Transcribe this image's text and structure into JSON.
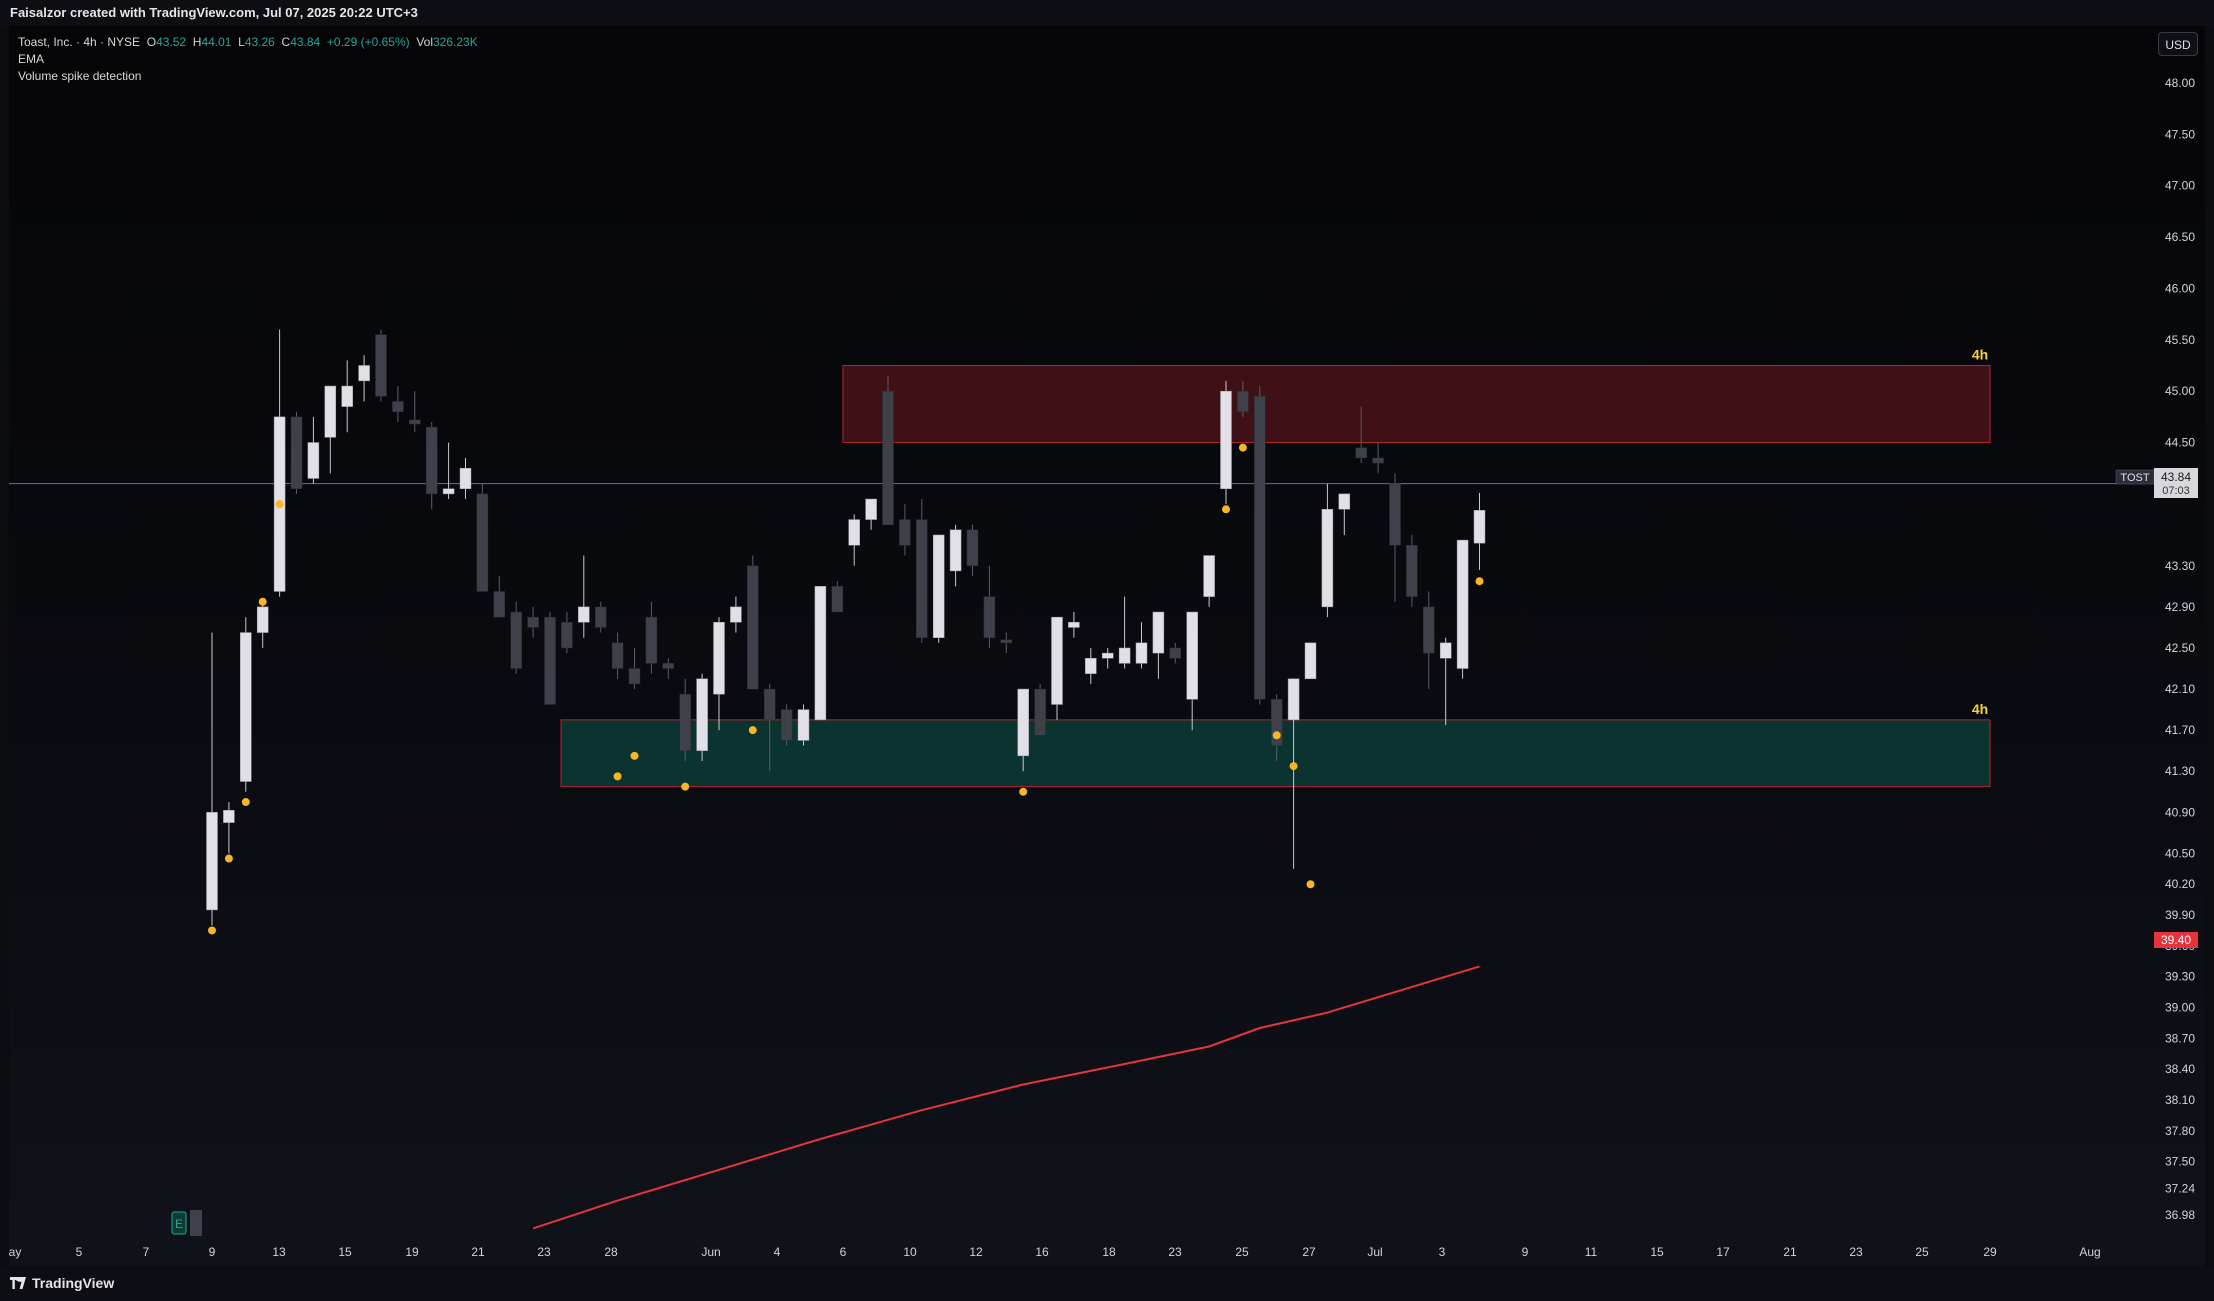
{
  "header": {
    "attribution": "Faisalzor created with TradingView.com, Jul 07, 2025 20:22 UTC+3"
  },
  "legend": {
    "symbol_line": "Toast, Inc. · 4h · NYSE",
    "o_label": "O",
    "o_value": "43.52",
    "h_label": "H",
    "h_value": "44.01",
    "l_label": "L",
    "l_value": "43.26",
    "c_label": "C",
    "c_value": "43.84",
    "change": "+0.29 (+0.65%)",
    "vol_label": "Vol",
    "vol_value": "326.23K",
    "indicator_1": "EMA",
    "indicator_2": "Volume spike detection"
  },
  "currency_button": "USD",
  "footer": {
    "brand": "TradingView"
  },
  "colors": {
    "bull": "#e0e0e6",
    "bear": "#3f414a",
    "dot": "#f7b623",
    "ema": "#e5343e",
    "hline": "#4a78c2",
    "resistance_fill": "#3f1016",
    "resistance_border": "#b2272e",
    "support_fill": "#0b3330",
    "support_border": "#b2272e",
    "zone_label": "#f5d238"
  },
  "chart_data": {
    "type": "candlestick",
    "symbol": "TOST",
    "timeframe": "4h",
    "y_axis": {
      "range": [
        36.84,
        48.35
      ],
      "ticks": [
        "48.00",
        "47.50",
        "47.00",
        "46.50",
        "46.00",
        "45.50",
        "45.00",
        "44.50",
        "44.10",
        "43.30",
        "42.90",
        "42.50",
        "42.10",
        "41.70",
        "41.30",
        "40.90",
        "40.50",
        "40.20",
        "39.90",
        "39.60",
        "39.30",
        "39.00",
        "38.70",
        "38.40",
        "38.10",
        "37.80",
        "37.50",
        "37.24",
        "36.98"
      ]
    },
    "x_axis": {
      "labels": [
        "ay",
        "5",
        "7",
        "9",
        "13",
        "15",
        "19",
        "21",
        "23",
        "28",
        "Jun",
        "4",
        "6",
        "10",
        "12",
        "16",
        "18",
        "23",
        "25",
        "27",
        "Jul",
        "3",
        "9",
        "11",
        "15",
        "17",
        "21",
        "23",
        "25",
        "29",
        "Aug"
      ]
    },
    "candles": [
      {
        "o": 39.95,
        "h": 42.65,
        "l": 39.8,
        "c": 40.9
      },
      {
        "o": 40.8,
        "h": 41.0,
        "l": 40.5,
        "c": 40.92
      },
      {
        "o": 41.2,
        "h": 42.8,
        "l": 41.1,
        "c": 42.65
      },
      {
        "o": 42.65,
        "h": 42.95,
        "l": 42.5,
        "c": 42.9
      },
      {
        "o": 43.05,
        "h": 45.6,
        "l": 43.0,
        "c": 44.75
      },
      {
        "o": 44.75,
        "h": 44.8,
        "l": 44.0,
        "c": 44.05
      },
      {
        "o": 44.15,
        "h": 44.75,
        "l": 44.1,
        "c": 44.5
      },
      {
        "o": 44.55,
        "h": 45.0,
        "l": 44.2,
        "c": 45.05
      },
      {
        "o": 44.85,
        "h": 45.3,
        "l": 44.6,
        "c": 45.05
      },
      {
        "o": 45.1,
        "h": 45.35,
        "l": 44.9,
        "c": 45.25
      },
      {
        "o": 45.55,
        "h": 45.6,
        "l": 44.9,
        "c": 44.95
      },
      {
        "o": 44.9,
        "h": 45.05,
        "l": 44.7,
        "c": 44.8
      },
      {
        "o": 44.72,
        "h": 45.0,
        "l": 44.6,
        "c": 44.68
      },
      {
        "o": 44.65,
        "h": 44.7,
        "l": 43.85,
        "c": 44.0
      },
      {
        "o": 44.0,
        "h": 44.5,
        "l": 43.95,
        "c": 44.05
      },
      {
        "o": 44.05,
        "h": 44.35,
        "l": 43.95,
        "c": 44.25
      },
      {
        "o": 44.0,
        "h": 44.1,
        "l": 43.05,
        "c": 43.05
      },
      {
        "o": 43.05,
        "h": 43.2,
        "l": 42.8,
        "c": 42.8
      },
      {
        "o": 42.85,
        "h": 42.95,
        "l": 42.25,
        "c": 42.3
      },
      {
        "o": 42.8,
        "h": 42.9,
        "l": 42.6,
        "c": 42.7
      },
      {
        "o": 42.8,
        "h": 42.85,
        "l": 41.95,
        "c": 41.95
      },
      {
        "o": 42.75,
        "h": 42.85,
        "l": 42.45,
        "c": 42.5
      },
      {
        "o": 42.75,
        "h": 43.4,
        "l": 42.6,
        "c": 42.9
      },
      {
        "o": 42.9,
        "h": 42.95,
        "l": 42.65,
        "c": 42.7
      },
      {
        "o": 42.55,
        "h": 42.65,
        "l": 42.2,
        "c": 42.3
      },
      {
        "o": 42.3,
        "h": 42.5,
        "l": 42.1,
        "c": 42.15
      },
      {
        "o": 42.8,
        "h": 42.95,
        "l": 42.25,
        "c": 42.35
      },
      {
        "o": 42.35,
        "h": 42.4,
        "l": 42.2,
        "c": 42.3
      },
      {
        "o": 42.05,
        "h": 42.2,
        "l": 41.4,
        "c": 41.5
      },
      {
        "o": 41.5,
        "h": 42.25,
        "l": 41.4,
        "c": 42.2
      },
      {
        "o": 42.05,
        "h": 42.8,
        "l": 41.7,
        "c": 42.75
      },
      {
        "o": 42.75,
        "h": 43.0,
        "l": 42.65,
        "c": 42.9
      },
      {
        "o": 43.3,
        "h": 43.4,
        "l": 42.1,
        "c": 42.1
      },
      {
        "o": 42.1,
        "h": 42.15,
        "l": 41.3,
        "c": 41.8
      },
      {
        "o": 41.9,
        "h": 41.95,
        "l": 41.55,
        "c": 41.6
      },
      {
        "o": 41.6,
        "h": 41.95,
        "l": 41.55,
        "c": 41.9
      },
      {
        "o": 41.8,
        "h": 43.1,
        "l": 41.8,
        "c": 43.1
      },
      {
        "o": 43.1,
        "h": 43.15,
        "l": 42.85,
        "c": 42.85
      },
      {
        "o": 43.5,
        "h": 43.8,
        "l": 43.3,
        "c": 43.75
      },
      {
        "o": 43.75,
        "h": 43.9,
        "l": 43.65,
        "c": 43.95
      },
      {
        "o": 45.0,
        "h": 45.15,
        "l": 43.7,
        "c": 43.7
      },
      {
        "o": 43.75,
        "h": 43.9,
        "l": 43.4,
        "c": 43.5
      },
      {
        "o": 43.75,
        "h": 43.95,
        "l": 42.55,
        "c": 42.6
      },
      {
        "o": 42.6,
        "h": 43.6,
        "l": 42.55,
        "c": 43.6
      },
      {
        "o": 43.25,
        "h": 43.7,
        "l": 43.1,
        "c": 43.65
      },
      {
        "o": 43.65,
        "h": 43.7,
        "l": 43.2,
        "c": 43.3
      },
      {
        "o": 43.0,
        "h": 43.3,
        "l": 42.5,
        "c": 42.6
      },
      {
        "o": 42.58,
        "h": 42.65,
        "l": 42.45,
        "c": 42.55
      },
      {
        "o": 41.45,
        "h": 42.1,
        "l": 41.3,
        "c": 42.1
      },
      {
        "o": 42.1,
        "h": 42.15,
        "l": 41.65,
        "c": 41.65
      },
      {
        "o": 41.95,
        "h": 42.8,
        "l": 41.8,
        "c": 42.8
      },
      {
        "o": 42.7,
        "h": 42.85,
        "l": 42.6,
        "c": 42.75
      },
      {
        "o": 42.25,
        "h": 42.5,
        "l": 42.15,
        "c": 42.4
      },
      {
        "o": 42.4,
        "h": 42.5,
        "l": 42.3,
        "c": 42.45
      },
      {
        "o": 42.35,
        "h": 43.0,
        "l": 42.3,
        "c": 42.5
      },
      {
        "o": 42.35,
        "h": 42.75,
        "l": 42.3,
        "c": 42.55
      },
      {
        "o": 42.45,
        "h": 42.85,
        "l": 42.2,
        "c": 42.85
      },
      {
        "o": 42.5,
        "h": 42.55,
        "l": 42.35,
        "c": 42.4
      },
      {
        "o": 42.0,
        "h": 42.85,
        "l": 41.7,
        "c": 42.85
      },
      {
        "o": 43.0,
        "h": 43.4,
        "l": 42.9,
        "c": 43.4
      },
      {
        "o": 44.05,
        "h": 45.1,
        "l": 43.9,
        "c": 45.0
      },
      {
        "o": 45.0,
        "h": 45.1,
        "l": 44.75,
        "c": 44.8
      },
      {
        "o": 44.95,
        "h": 45.05,
        "l": 41.95,
        "c": 42.0
      },
      {
        "o": 42.0,
        "h": 42.05,
        "l": 41.4,
        "c": 41.55
      },
      {
        "o": 41.8,
        "h": 42.2,
        "l": 40.35,
        "c": 42.2
      },
      {
        "o": 42.2,
        "h": 42.55,
        "l": 42.2,
        "c": 42.55
      },
      {
        "o": 42.9,
        "h": 44.1,
        "l": 42.8,
        "c": 43.85
      },
      {
        "o": 43.85,
        "h": 44.0,
        "l": 43.6,
        "c": 44.0
      },
      {
        "o": 44.45,
        "h": 44.85,
        "l": 44.3,
        "c": 44.35
      },
      {
        "o": 44.35,
        "h": 44.5,
        "l": 44.2,
        "c": 44.3
      },
      {
        "o": 44.1,
        "h": 44.2,
        "l": 42.95,
        "c": 43.5
      },
      {
        "o": 43.5,
        "h": 43.6,
        "l": 42.9,
        "c": 43.0
      },
      {
        "o": 42.9,
        "h": 43.05,
        "l": 42.1,
        "c": 42.45
      },
      {
        "o": 42.4,
        "h": 42.6,
        "l": 41.75,
        "c": 42.55
      },
      {
        "o": 42.3,
        "h": 43.55,
        "l": 42.2,
        "c": 43.55
      },
      {
        "o": 43.52,
        "h": 44.01,
        "l": 43.26,
        "c": 43.84
      }
    ],
    "ema": [
      {
        "i": 19,
        "v": 36.85
      },
      {
        "i": 24,
        "v": 37.12
      },
      {
        "i": 30,
        "v": 37.42
      },
      {
        "i": 36,
        "v": 37.72
      },
      {
        "i": 42,
        "v": 38.0
      },
      {
        "i": 48,
        "v": 38.25
      },
      {
        "i": 54,
        "v": 38.45
      },
      {
        "i": 59,
        "v": 38.62
      },
      {
        "i": 62,
        "v": 38.8
      },
      {
        "i": 66,
        "v": 38.95
      },
      {
        "i": 70,
        "v": 39.15
      },
      {
        "i": 72,
        "v": 39.25
      },
      {
        "i": 75,
        "v": 39.4
      }
    ],
    "volume_spike_marks": [
      {
        "i": 0,
        "v": 39.75
      },
      {
        "i": 1,
        "v": 40.45
      },
      {
        "i": 2,
        "v": 41.0
      },
      {
        "i": 3,
        "v": 42.95
      },
      {
        "i": 4,
        "v": 43.9
      },
      {
        "i": 24,
        "v": 41.25
      },
      {
        "i": 25,
        "v": 41.45
      },
      {
        "i": 28,
        "v": 41.15
      },
      {
        "i": 32,
        "v": 41.7
      },
      {
        "i": 48,
        "v": 41.1
      },
      {
        "i": 60,
        "v": 43.85
      },
      {
        "i": 61,
        "v": 44.45
      },
      {
        "i": 63,
        "v": 41.65
      },
      {
        "i": 64,
        "v": 41.35
      },
      {
        "i": 65,
        "v": 40.2
      },
      {
        "i": 75,
        "v": 43.15
      }
    ],
    "zones": [
      {
        "kind": "resistance",
        "top": 45.25,
        "bottom": 44.5,
        "label": "4h"
      },
      {
        "kind": "support",
        "top": 41.8,
        "bottom": 41.15,
        "label": "4h"
      }
    ],
    "horizontal_line": {
      "value": 44.1,
      "label": "44.10"
    },
    "price_marker": {
      "symbol": "TOST",
      "price": "43.84",
      "countdown": "07:03"
    },
    "ema_marker": {
      "price": "39.40"
    },
    "earnings_flag": {
      "label": "E"
    }
  }
}
